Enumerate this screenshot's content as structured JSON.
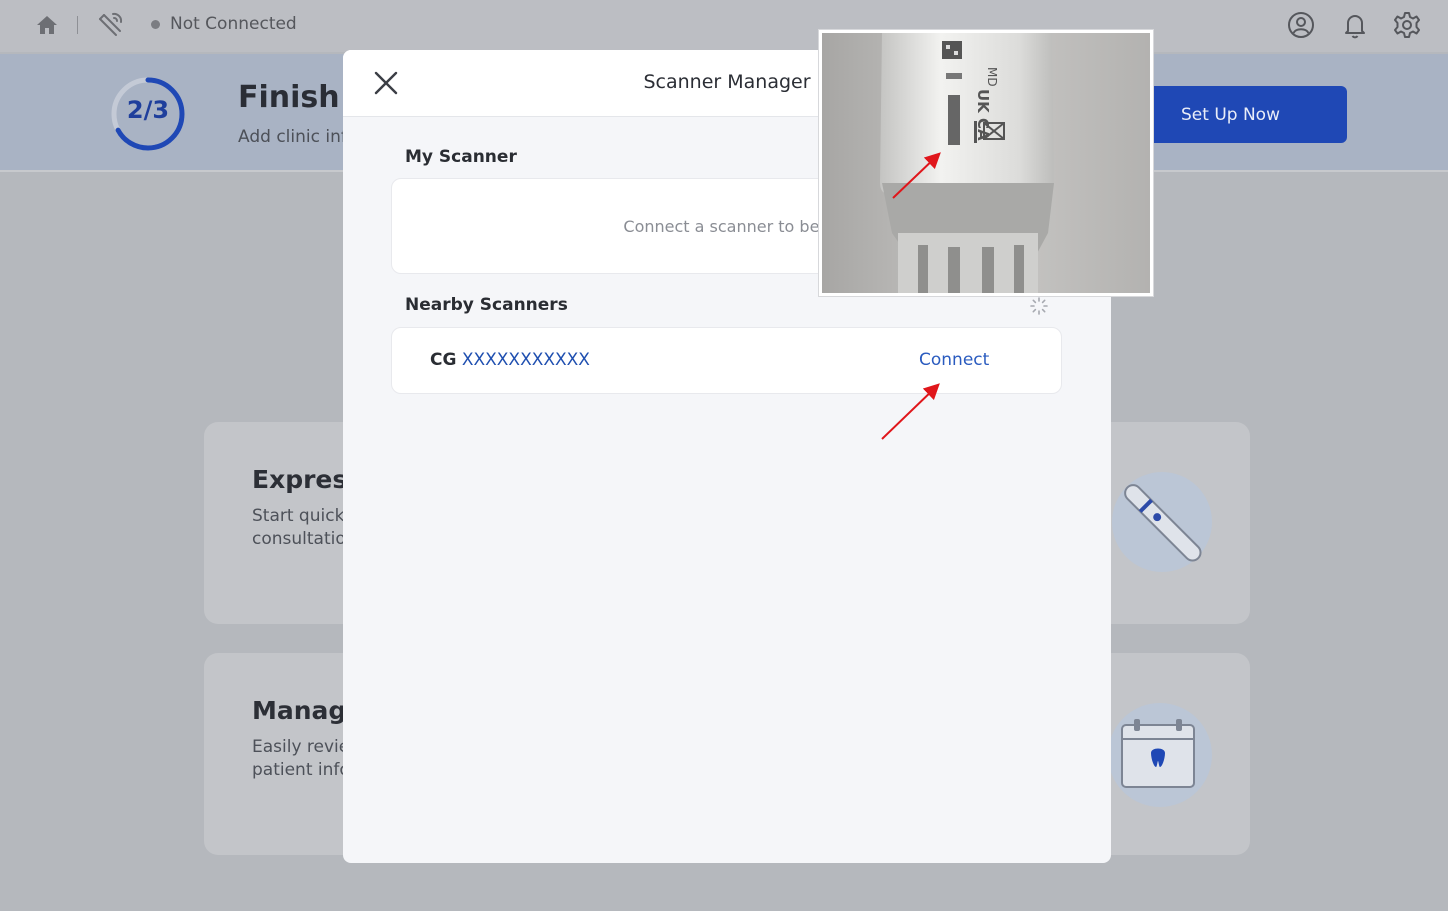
{
  "topbar": {
    "status": "Not Connected",
    "icons": [
      "home-icon",
      "scanner-signal-icon",
      "account-icon",
      "bell-icon",
      "gear-icon"
    ]
  },
  "banner": {
    "progress": "2/3",
    "progress_fraction": 0.67,
    "title": "Finish s",
    "subtitle": "Add clinic info",
    "button": "Set Up Now"
  },
  "cards": [
    {
      "title": "Express",
      "desc_line1": "Start quick s",
      "desc_line2": "consultation"
    },
    {
      "title": "Manage",
      "desc_line1": "Easily review",
      "desc_line2": "patient info"
    }
  ],
  "modal": {
    "title": "Scanner Manager",
    "my_scanner_label": "My Scanner",
    "empty_text": "Connect a scanner to beg",
    "nearby_label": "Nearby Scanners",
    "scanner": {
      "prefix": "CG",
      "serial": "XXXXXXXXXXX",
      "action": "Connect"
    }
  },
  "photo": {
    "labels": [
      "MD",
      "UK CA"
    ]
  },
  "colors": {
    "accent": "#1f48b5",
    "link": "#2a5bbf",
    "annotation_arrow": "#e0161b"
  }
}
